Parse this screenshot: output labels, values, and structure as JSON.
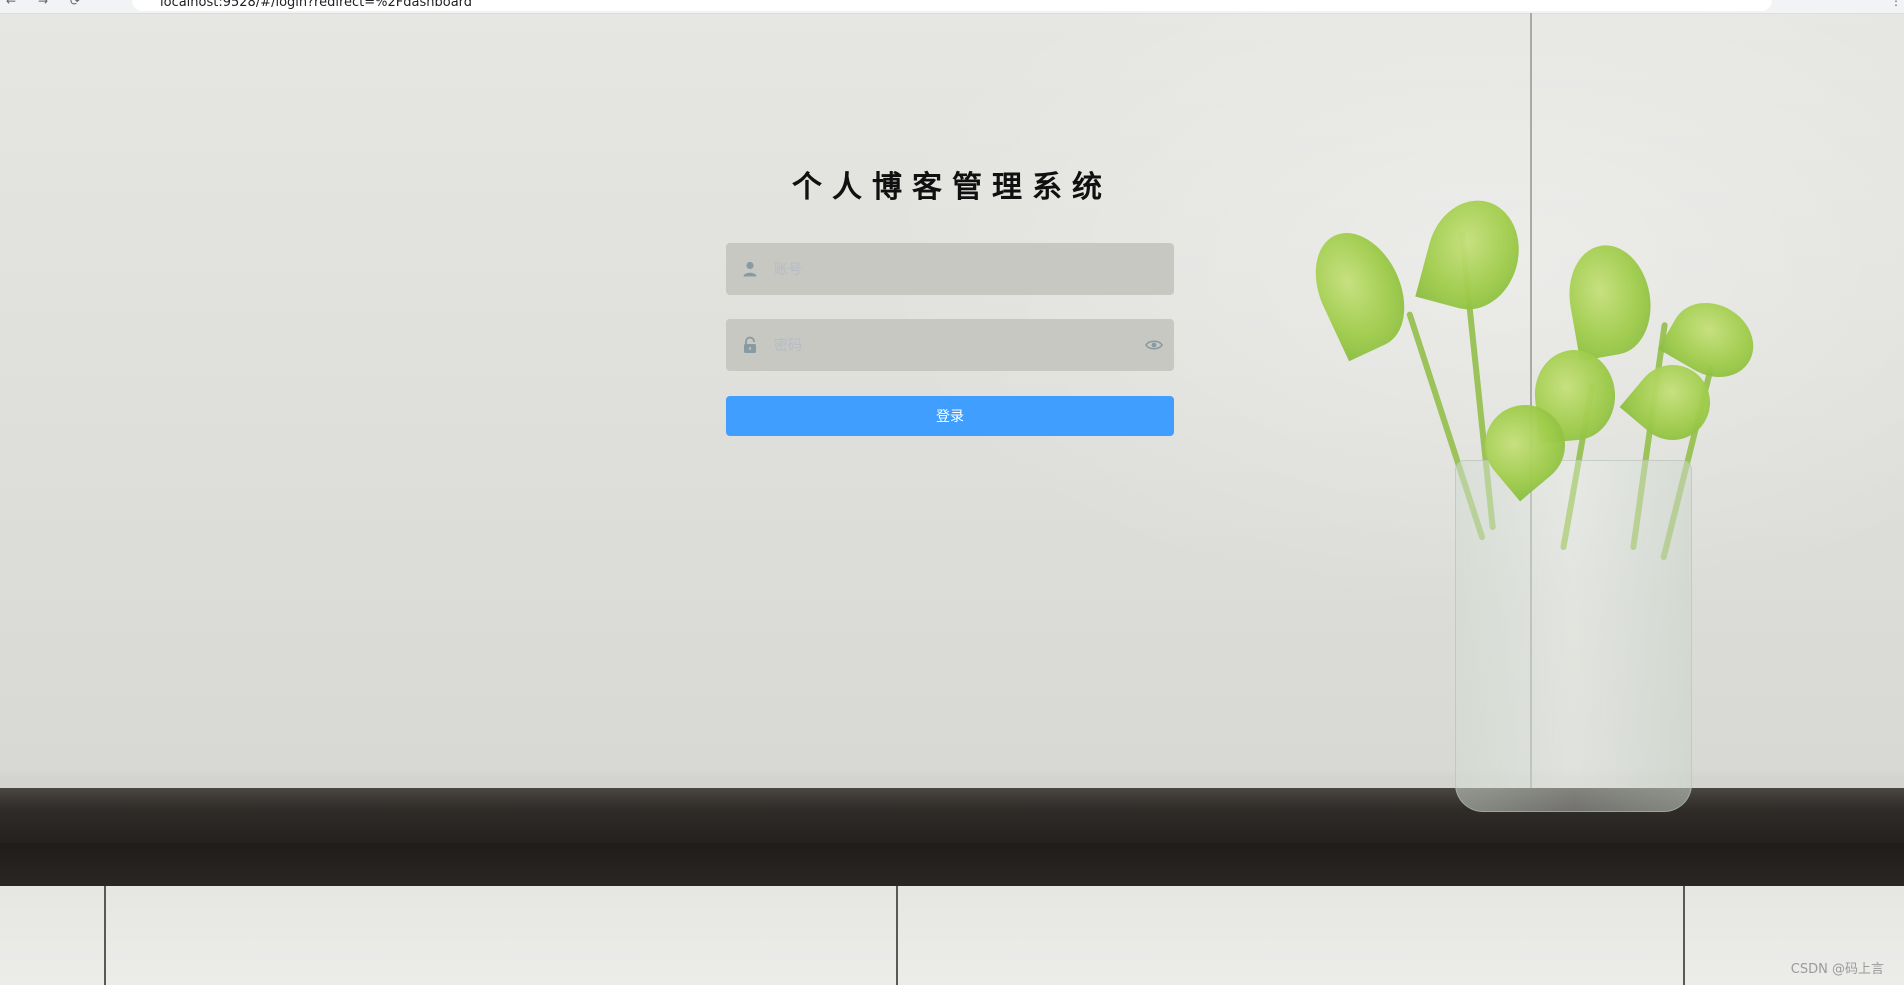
{
  "browser": {
    "url": "localhost:9528/#/login?redirect=%2Fdashboard",
    "nav_back": "←",
    "nav_forward": "→",
    "nav_reload": "⟳",
    "menu": "⋮"
  },
  "login": {
    "title": "个人博客管理系统",
    "username_placeholder": "账号",
    "password_placeholder": "密码",
    "login_button": "登录"
  },
  "watermark": "CSDN @码上言",
  "colors": {
    "primary": "#409eff",
    "input_bg": "#c4c4be",
    "title": "#101010"
  },
  "icons": {
    "username": "user-icon",
    "password": "lock-icon",
    "toggle_password": "eye-icon"
  }
}
